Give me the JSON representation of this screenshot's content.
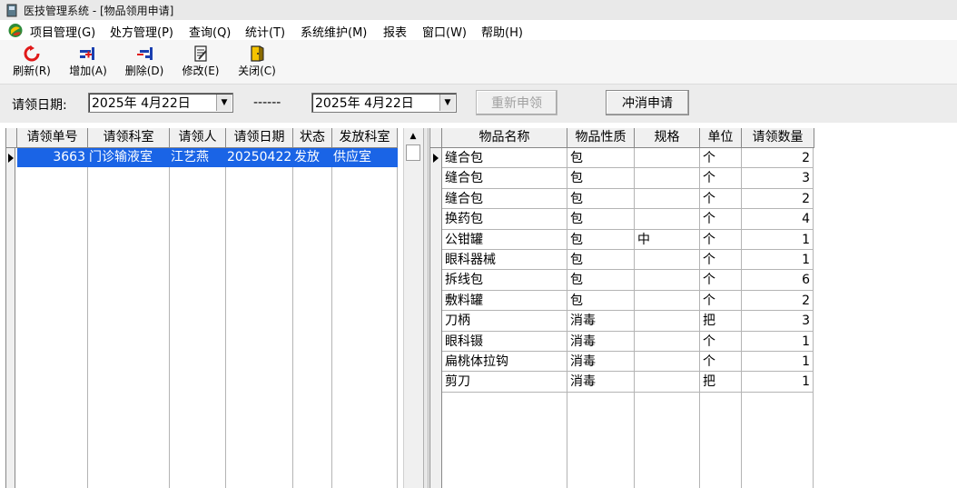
{
  "window": {
    "title": "医技管理系统 - [物品领用申请]"
  },
  "menu": [
    "项目管理(G)",
    "处方管理(P)",
    "查询(Q)",
    "统计(T)",
    "系统维护(M)",
    "报表",
    "窗口(W)",
    "帮助(H)"
  ],
  "toolbar": {
    "refresh": "刷新(R)",
    "add": "增加(A)",
    "delete": "删除(D)",
    "edit": "修改(E)",
    "close": "关闭(C)"
  },
  "filter": {
    "date_label": "请领日期:",
    "date_from": "2025年  4月22日",
    "separator": "------",
    "date_to": "2025年  4月22日",
    "reapply": "重新申领",
    "cancel_apply": "冲消申请"
  },
  "left_grid": {
    "headers": [
      "请领单号",
      "请领科室",
      "请领人",
      "请领日期",
      "状态",
      "发放科室"
    ],
    "rows": [
      [
        "3663",
        "门诊输液室",
        "江艺燕",
        "20250422",
        "发放",
        "供应室"
      ]
    ]
  },
  "right_grid": {
    "headers": [
      "物品名称",
      "物品性质",
      "规格",
      "单位",
      "请领数量"
    ],
    "rows": [
      [
        "缝合包",
        "包",
        "",
        "个",
        "2"
      ],
      [
        "缝合包",
        "包",
        "",
        "个",
        "3"
      ],
      [
        "缝合包",
        "包",
        "",
        "个",
        "2"
      ],
      [
        "换药包",
        "包",
        "",
        "个",
        "4"
      ],
      [
        "公钳罐",
        "包",
        "中",
        "个",
        "1"
      ],
      [
        "眼科器械",
        "包",
        "",
        "个",
        "1"
      ],
      [
        "拆线包",
        "包",
        "",
        "个",
        "6"
      ],
      [
        "敷料罐",
        "包",
        "",
        "个",
        "2"
      ],
      [
        "刀柄",
        "消毒",
        "",
        "把",
        "3"
      ],
      [
        "眼科镊",
        "消毒",
        "",
        "个",
        "1"
      ],
      [
        "扁桃体拉钩",
        "消毒",
        "",
        "个",
        "1"
      ],
      [
        "剪刀",
        "消毒",
        "",
        "把",
        "1"
      ]
    ]
  },
  "colors": {
    "selection": "#1a64e6",
    "titlebar": "#e9e9e9",
    "toolbar": "#f6f6f6",
    "icon_red": "#e01919",
    "icon_blue": "#1a3fb0"
  }
}
